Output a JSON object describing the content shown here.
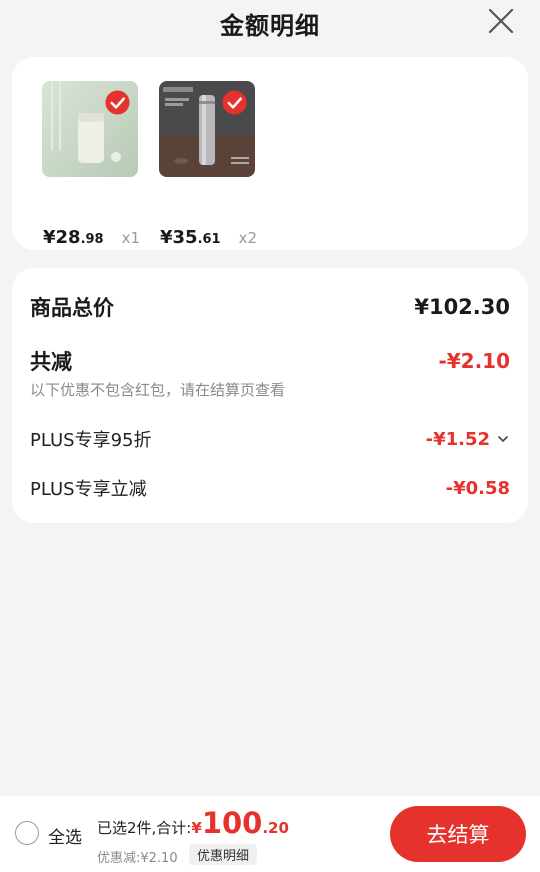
{
  "header": {
    "title": "金额明细"
  },
  "products": [
    {
      "price_main": "¥28",
      "price_dec": ".98",
      "qty": "x1"
    },
    {
      "price_main": "¥35",
      "price_dec": ".61",
      "qty": "x2"
    }
  ],
  "summary": {
    "total_label": "商品总价",
    "total_value": "¥102.30",
    "reduce_label": "共减",
    "reduce_value": "-¥2.10",
    "note": "以下优惠不包含红包，请在结算页查看",
    "items": [
      {
        "label": "PLUS专享95折",
        "value": "-¥1.52"
      },
      {
        "label": "PLUS专享立减",
        "value": "-¥0.58"
      }
    ]
  },
  "footer": {
    "select_all": "全选",
    "selected_text": "已选2件,合计:",
    "yen": "¥",
    "amount_int": "100",
    "amount_dec": ".20",
    "discount_text": "优惠减:¥2.10",
    "detail_button": "优惠明细",
    "checkout_button": "去结算"
  },
  "colors": {
    "accent": "#e5322d",
    "background": "#f4f4f4"
  }
}
